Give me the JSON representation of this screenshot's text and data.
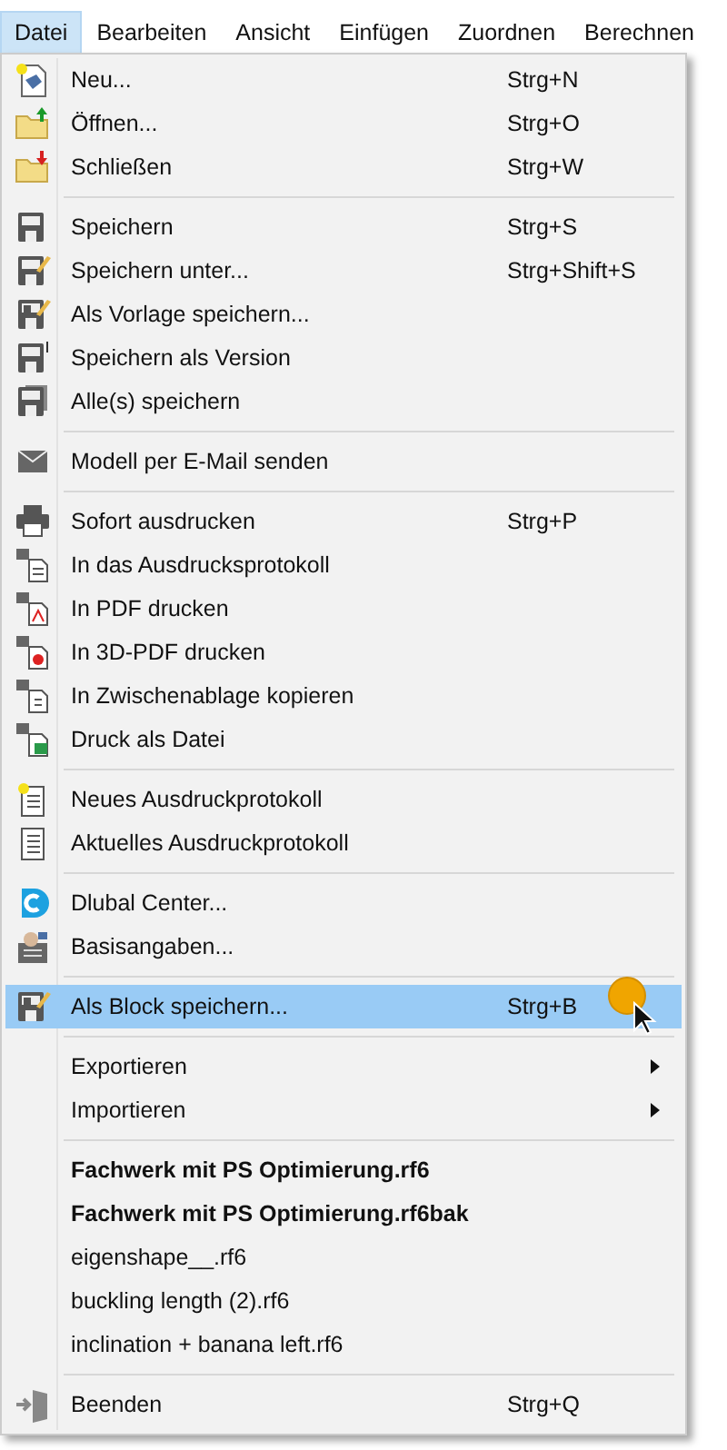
{
  "menubar": [
    {
      "label": "Datei",
      "selected": true
    },
    {
      "label": "Bearbeiten",
      "selected": false
    },
    {
      "label": "Ansicht",
      "selected": false
    },
    {
      "label": "Einfügen",
      "selected": false
    },
    {
      "label": "Zuordnen",
      "selected": false
    },
    {
      "label": "Berechnen",
      "selected": false
    }
  ],
  "menu": {
    "groups": [
      {
        "items": [
          {
            "label": "Neu...",
            "shortcut": "Strg+N",
            "selected": false
          },
          {
            "label": "Öffnen...",
            "shortcut": "Strg+O",
            "selected": false
          },
          {
            "label": "Schließen",
            "shortcut": "Strg+W",
            "selected": false
          }
        ]
      },
      {
        "items": [
          {
            "label": "Speichern",
            "shortcut": "Strg+S",
            "selected": false
          },
          {
            "label": "Speichern unter...",
            "shortcut": "Strg+Shift+S",
            "selected": false
          },
          {
            "label": "Als Vorlage speichern...",
            "selected": false
          },
          {
            "label": "Speichern als Version",
            "selected": false
          },
          {
            "label": "Alle(s) speichern",
            "selected": false
          }
        ]
      },
      {
        "items": [
          {
            "label": "Modell per E-Mail senden",
            "selected": false
          }
        ]
      },
      {
        "items": [
          {
            "label": "Sofort ausdrucken",
            "shortcut": "Strg+P",
            "selected": false
          },
          {
            "label": "In das Ausdrucksprotokoll",
            "selected": false
          },
          {
            "label": "In PDF drucken",
            "selected": false
          },
          {
            "label": "In 3D-PDF drucken",
            "selected": false
          },
          {
            "label": "In Zwischenablage kopieren",
            "selected": false
          },
          {
            "label": "Druck als Datei",
            "selected": false
          }
        ]
      },
      {
        "items": [
          {
            "label": "Neues Ausdruckprotokoll",
            "selected": false
          },
          {
            "label": "Aktuelles Ausdruckprotokoll",
            "selected": false
          }
        ]
      },
      {
        "items": [
          {
            "label": "Dlubal Center...",
            "selected": false
          },
          {
            "label": "Basisangaben...",
            "selected": false
          }
        ]
      },
      {
        "items": [
          {
            "label": "Als Block speichern...",
            "shortcut": "Strg+B",
            "selected": true
          }
        ]
      },
      {
        "items": [
          {
            "label": "Exportieren",
            "submenu": true,
            "selected": false
          },
          {
            "label": "Importieren",
            "submenu": true,
            "selected": false
          }
        ]
      },
      {
        "items": [
          {
            "label": "Fachwerk mit PS Optimierung.rf6",
            "bold": true,
            "selected": false
          },
          {
            "label": "Fachwerk mit PS Optimierung.rf6bak",
            "bold": true,
            "selected": false
          },
          {
            "label": "eigenshape__.rf6",
            "bold": false,
            "selected": false
          },
          {
            "label": "buckling length (2).rf6",
            "bold": false,
            "selected": false
          },
          {
            "label": "inclination + banana left.rf6",
            "bold": false,
            "selected": false
          }
        ]
      },
      {
        "items": [
          {
            "label": "Beenden",
            "shortcut": "Strg+Q",
            "selected": false
          }
        ]
      }
    ]
  }
}
